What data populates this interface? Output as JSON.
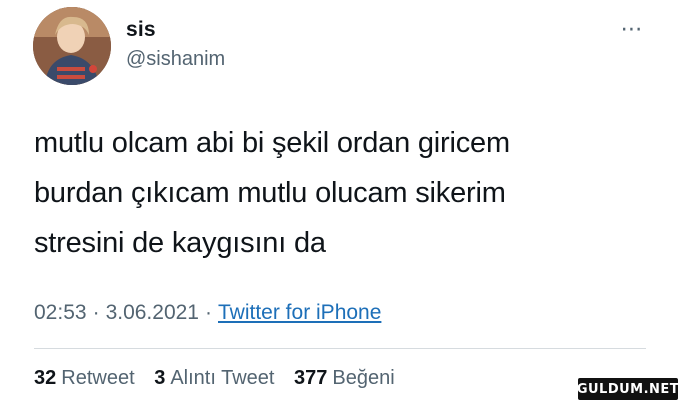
{
  "user": {
    "display_name": "sis",
    "handle": "@sishanim"
  },
  "more_icon": "⋯",
  "tweet": {
    "lines": [
      "mutlu olcam abi bi şekil ordan giricem",
      "burdan çıkıcam mutlu olucam sikerim",
      "stresini de kaygısını da"
    ],
    "time": "02:53",
    "date": "3.06.2021",
    "separator": "·",
    "source": "Twitter for iPhone"
  },
  "stats": {
    "retweets": {
      "count": "32",
      "label": "Retweet"
    },
    "quotes": {
      "count": "3",
      "label": "Alıntı Tweet"
    },
    "likes": {
      "count": "377",
      "label": "Beğeni"
    }
  },
  "watermark": "GULDUM.NET",
  "colors": {
    "text": "#0f1419",
    "secondary": "#536471",
    "link": "#1d6fb8",
    "divider": "#d6dbdf"
  }
}
